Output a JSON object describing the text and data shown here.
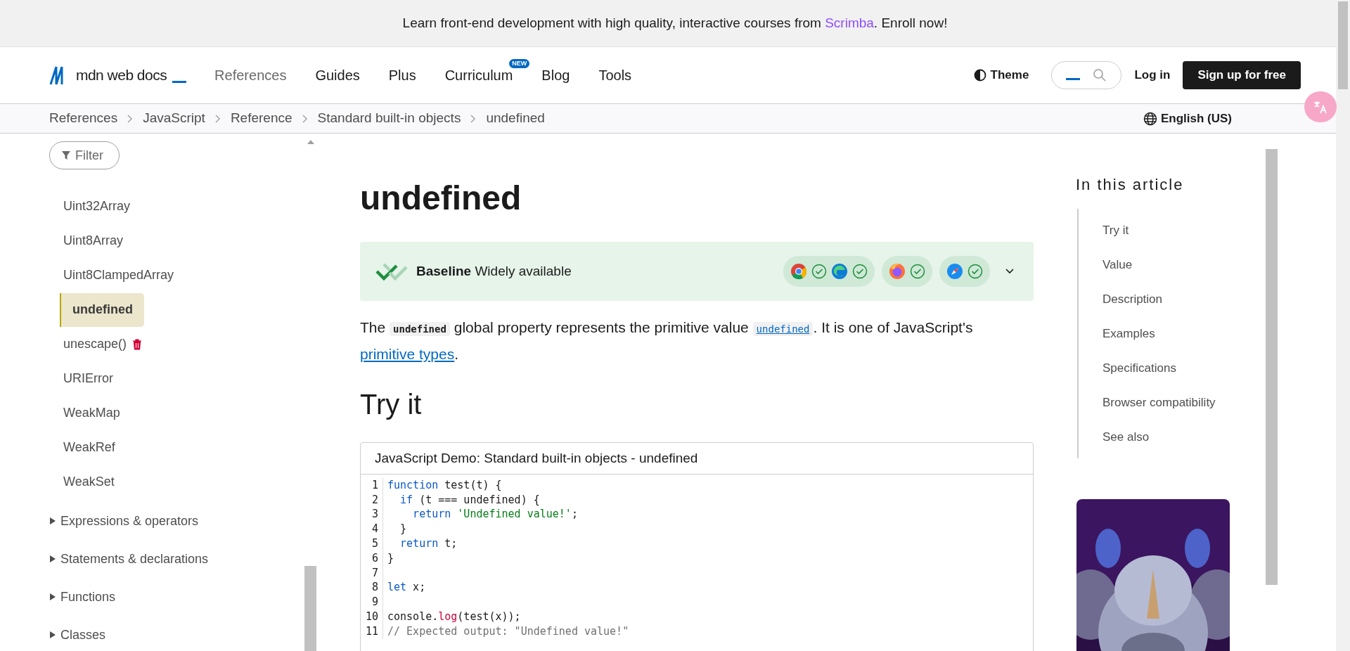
{
  "banner": [
    {
      "text": "Learn front-end development with high quality, interactive courses from ",
      "kind": "text"
    },
    {
      "text": "Scrimba",
      "kind": "link"
    },
    {
      "text": ". Enroll now!",
      "kind": "text"
    }
  ],
  "header": {
    "logo": "mdn web docs",
    "nav": [
      {
        "label": "References",
        "selected": true
      },
      {
        "label": "Guides",
        "selected": false
      },
      {
        "label": "Plus",
        "selected": false
      },
      {
        "label": "Curriculum",
        "selected": false,
        "badge": "NEW"
      },
      {
        "label": "Blog",
        "selected": false
      },
      {
        "label": "Tools",
        "selected": false
      }
    ],
    "theme": "Theme",
    "login": "Log in",
    "signup": "Sign up for free"
  },
  "breadcrumbs": [
    "References",
    "JavaScript",
    "Reference",
    "Standard built-in objects",
    "undefined"
  ],
  "language": "English (US)",
  "sidebar": {
    "filter": "Filter",
    "items": [
      {
        "label": "Uint32Array",
        "kind": "page",
        "selected": false,
        "deprecated": false
      },
      {
        "label": "Uint8Array",
        "kind": "page",
        "selected": false,
        "deprecated": false
      },
      {
        "label": "Uint8ClampedArray",
        "kind": "page",
        "selected": false,
        "deprecated": false
      },
      {
        "label": "undefined",
        "kind": "page",
        "selected": true,
        "deprecated": false
      },
      {
        "label": "unescape()",
        "kind": "page",
        "selected": false,
        "deprecated": true
      },
      {
        "label": "URIError",
        "kind": "page",
        "selected": false,
        "deprecated": false
      },
      {
        "label": "WeakMap",
        "kind": "page",
        "selected": false,
        "deprecated": false
      },
      {
        "label": "WeakRef",
        "kind": "page",
        "selected": false,
        "deprecated": false
      },
      {
        "label": "WeakSet",
        "kind": "page",
        "selected": false,
        "deprecated": false
      },
      {
        "label": "Expressions & operators",
        "kind": "group",
        "expanded": false
      },
      {
        "label": "Statements & declarations",
        "kind": "group",
        "expanded": false
      },
      {
        "label": "Functions",
        "kind": "group",
        "expanded": false
      },
      {
        "label": "Classes",
        "kind": "group",
        "expanded": false
      }
    ]
  },
  "article": {
    "title": "undefined",
    "baseline": {
      "label": "Baseline",
      "status": "Widely available"
    },
    "intro": [
      {
        "text": "The ",
        "kind": "text"
      },
      {
        "text": "undefined",
        "kind": "code"
      },
      {
        "text": " global property represents the primitive value ",
        "kind": "text"
      },
      {
        "text": "undefined",
        "kind": "code-link"
      },
      {
        "text": ". It is one of JavaScript's ",
        "kind": "text"
      },
      {
        "text": "primitive types",
        "kind": "link"
      },
      {
        "text": ".",
        "kind": "text"
      }
    ],
    "try_it": "Try it",
    "demo": {
      "title": "JavaScript Demo: Standard built-in objects - undefined",
      "lines": [
        {
          "number": "1",
          "tokens": [
            {
              "text": "function",
              "kind": "keyword"
            },
            {
              "text": " test(t) {",
              "kind": "plain"
            }
          ]
        },
        {
          "number": "2",
          "tokens": [
            {
              "text": "  if",
              "kind": "keyword"
            },
            {
              "text": " (t === undefined) {",
              "kind": "plain"
            }
          ]
        },
        {
          "number": "3",
          "tokens": [
            {
              "text": "    return",
              "kind": "keyword"
            },
            {
              "text": " 'Undefined value!'",
              "kind": "string"
            },
            {
              "text": ";",
              "kind": "plain"
            }
          ]
        },
        {
          "number": "4",
          "tokens": [
            {
              "text": "  }",
              "kind": "plain"
            }
          ]
        },
        {
          "number": "5",
          "tokens": [
            {
              "text": "  return",
              "kind": "keyword"
            },
            {
              "text": " t;",
              "kind": "plain"
            }
          ]
        },
        {
          "number": "6",
          "tokens": [
            {
              "text": "}",
              "kind": "plain"
            }
          ]
        },
        {
          "number": "7"
        },
        {
          "number": "8",
          "tokens": [
            {
              "text": "let",
              "kind": "keyword"
            },
            {
              "text": " x;",
              "kind": "plain"
            }
          ]
        },
        {
          "number": "9"
        },
        {
          "number": "10",
          "tokens": [
            {
              "text": "console.",
              "kind": "plain"
            },
            {
              "text": "log",
              "kind": "call"
            },
            {
              "text": "(test(x));",
              "kind": "plain"
            }
          ]
        },
        {
          "number": "11",
          "tokens": [
            {
              "text": "// Expected output: \"Undefined value!\"",
              "kind": "comment"
            }
          ]
        }
      ]
    }
  },
  "toc": {
    "title": "In this article",
    "items": [
      "Try it",
      "Value",
      "Description",
      "Examples",
      "Specifications",
      "Browser compatibility",
      "See also"
    ]
  },
  "ad": {
    "kind": "picture"
  }
}
